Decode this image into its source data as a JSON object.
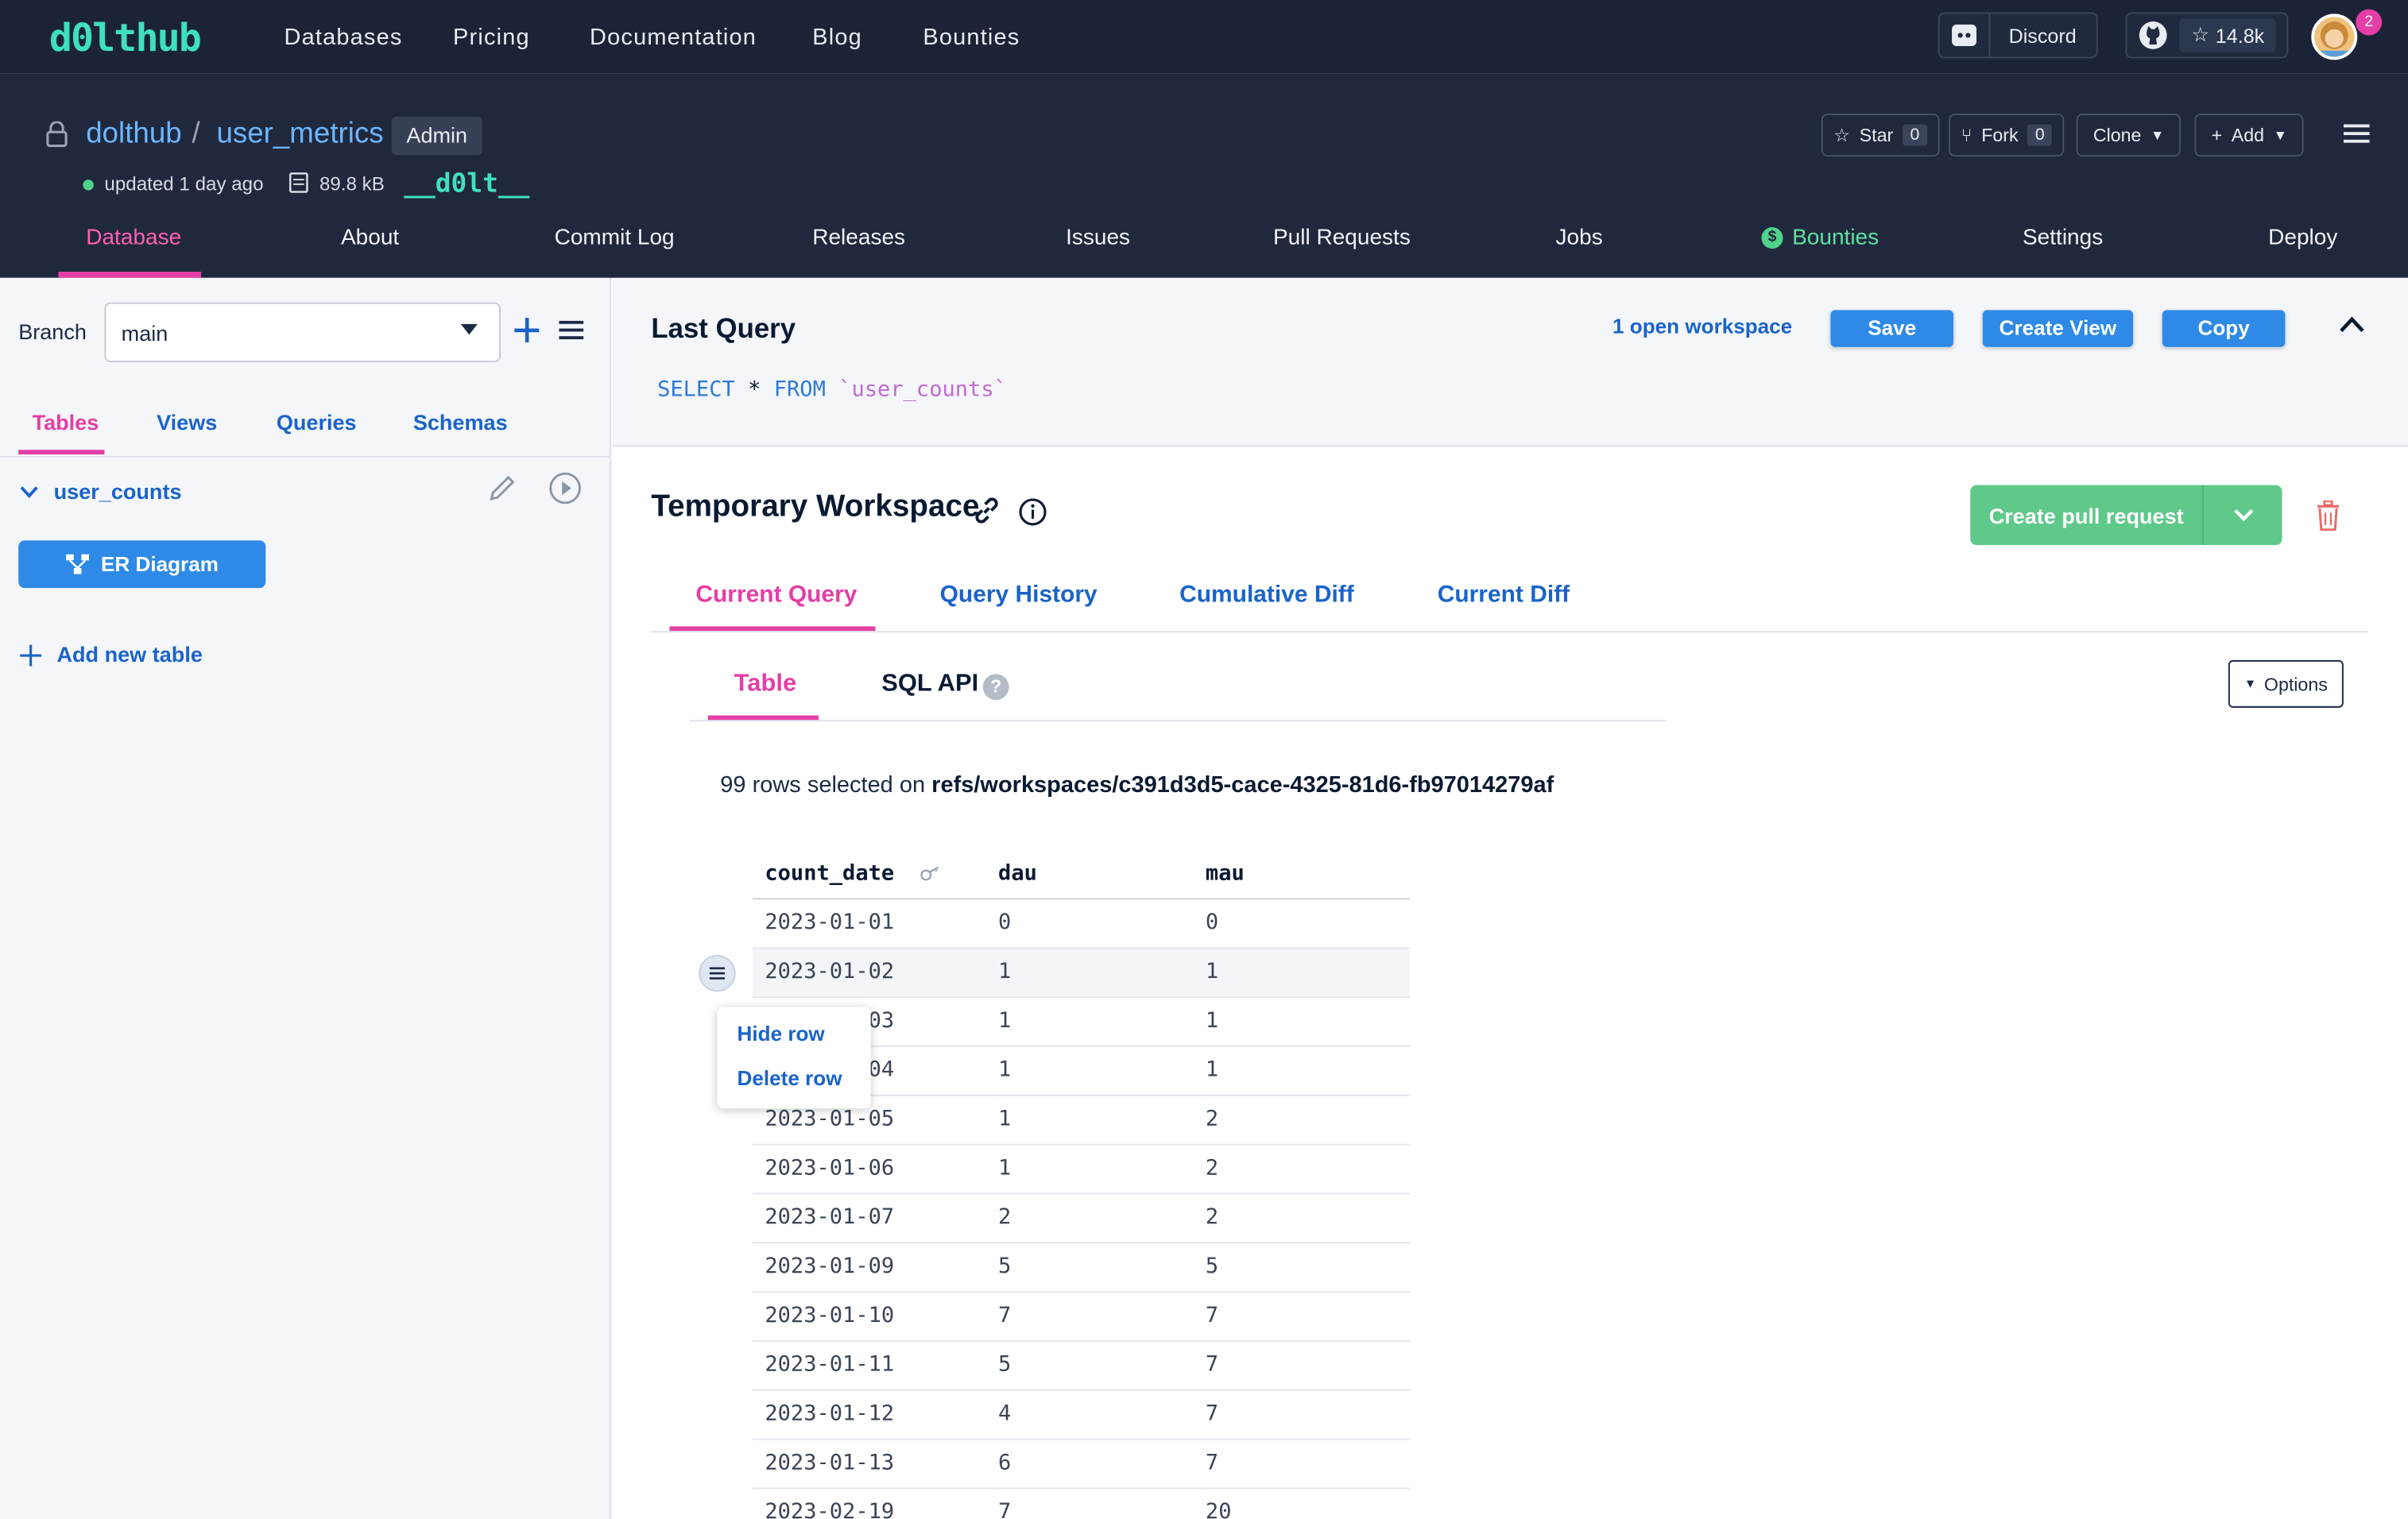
{
  "nav": {
    "logo": "d0lthub",
    "links": [
      "Databases",
      "Pricing",
      "Documentation",
      "Blog",
      "Bounties"
    ],
    "discord_label": "Discord",
    "github_stars": "14.8k",
    "notification_count": "2"
  },
  "repo": {
    "owner": "dolthub",
    "separator": "/",
    "name": "user_metrics",
    "role_badge": "Admin",
    "updated": "updated 1 day ago",
    "size": "89.8 kB",
    "dolt_logo": "__d0lt__",
    "star_label": "Star",
    "star_count": "0",
    "fork_label": "Fork",
    "fork_count": "0",
    "clone_label": "Clone",
    "add_label": "Add",
    "tabs": [
      "Database",
      "About",
      "Commit Log",
      "Releases",
      "Issues",
      "Pull Requests",
      "Jobs",
      "Bounties",
      "Settings",
      "Deploy"
    ],
    "active_tab": "Database"
  },
  "sidebar": {
    "branch_label": "Branch",
    "branch_value": "main",
    "tabs": [
      "Tables",
      "Views",
      "Queries",
      "Schemas"
    ],
    "active_tab": "Tables",
    "table_name": "user_counts",
    "er_button": "ER Diagram",
    "add_table": "Add new table"
  },
  "last_query": {
    "title": "Last Query",
    "workspace_link": "1 open workspace",
    "save": "Save",
    "create_view": "Create View",
    "copy": "Copy",
    "sql_keyword1": "SELECT",
    "sql_star": "*",
    "sql_keyword2": "FROM",
    "sql_table": "`user_counts`"
  },
  "workspace": {
    "title": "Temporary Workspace",
    "create_pr": "Create pull request",
    "tabs": [
      "Current Query",
      "Query History",
      "Cumulative Diff",
      "Current Diff"
    ],
    "active_tab": "Current Query",
    "subtabs": [
      "Table",
      "SQL API"
    ],
    "active_subtab": "Table",
    "options": "Options",
    "rows_prefix": "99 rows selected on",
    "ref": "refs/workspaces/c391d3d5-cace-4325-81d6-fb97014279af"
  },
  "result_table": {
    "columns": [
      "count_date",
      "dau",
      "mau"
    ],
    "rows": [
      [
        "2023-01-01",
        "0",
        "0"
      ],
      [
        "2023-01-02",
        "1",
        "1"
      ],
      [
        "2023-01-03",
        "1",
        "1"
      ],
      [
        "2023-01-04",
        "1",
        "1"
      ],
      [
        "2023-01-05",
        "1",
        "2"
      ],
      [
        "2023-01-06",
        "1",
        "2"
      ],
      [
        "2023-01-07",
        "2",
        "2"
      ],
      [
        "2023-01-09",
        "5",
        "5"
      ],
      [
        "2023-01-10",
        "7",
        "7"
      ],
      [
        "2023-01-11",
        "5",
        "7"
      ],
      [
        "2023-01-12",
        "4",
        "7"
      ],
      [
        "2023-01-13",
        "6",
        "7"
      ],
      [
        "2023-02-19",
        "7",
        "20"
      ]
    ]
  },
  "row_menu": {
    "hide": "Hide row",
    "delete": "Delete row"
  },
  "colors": {
    "nav_bg": "#1b2437",
    "header_bg": "#20283d",
    "accent_pink": "#e53ea6",
    "link_blue": "#1a63c9",
    "button_blue": "#2e8ae6",
    "pr_green": "#5fc98a"
  }
}
